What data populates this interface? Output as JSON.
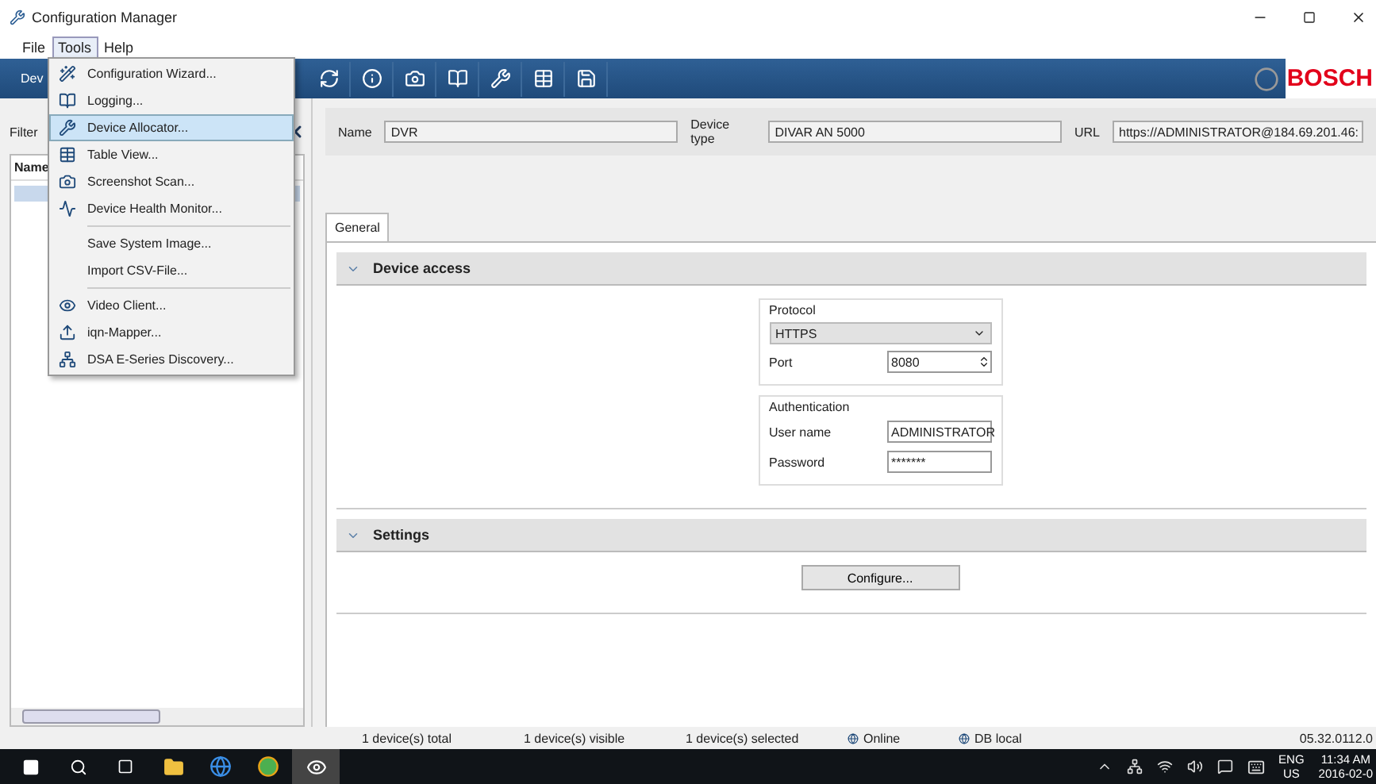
{
  "window": {
    "title": "Configuration Manager"
  },
  "menu": [
    {
      "label": "File",
      "selected": false
    },
    {
      "label": "Tools",
      "selected": true
    },
    {
      "label": "Help",
      "selected": false
    }
  ],
  "tools_menu": [
    [
      {
        "label": "Configuration Wizard...",
        "selected": false
      },
      {
        "label": "Logging...",
        "selected": false
      },
      {
        "label": "Device Allocator...",
        "selected": true
      },
      {
        "label": "Table View...",
        "selected": false
      },
      {
        "label": "Screenshot Scan...",
        "selected": false
      },
      {
        "label": "Device Health Monitor...",
        "selected": false
      }
    ],
    [
      {
        "label": "Save System Image...",
        "selected": false
      },
      {
        "label": "Import CSV-File...",
        "selected": false
      }
    ],
    [
      {
        "label": "Video Client...",
        "selected": false
      },
      {
        "label": "iqn-Mapper...",
        "selected": false
      },
      {
        "label": "DSA E-Series Discovery...",
        "selected": false
      }
    ]
  ],
  "logo": "BOSCH",
  "left_panel": {
    "tab": "Dev",
    "filter_label": "Filter",
    "column": "Name"
  },
  "device_fields": [
    {
      "label": "Name",
      "value": "DVR"
    },
    {
      "label": "Device type",
      "value": "DIVAR AN 5000"
    },
    {
      "label": "URL",
      "value": "https://ADMINISTRATOR@184.69.201.46:"
    }
  ],
  "tabs": [
    {
      "label": "General",
      "selected": true
    }
  ],
  "device_access": {
    "title": "Device access",
    "expanded": true,
    "protocol_title": "Protocol",
    "protocol": "HTTPS",
    "port_label": "Port",
    "port": "8080",
    "auth_title": "Authentication",
    "user_label": "User name",
    "user": "ADMINISTRATOR",
    "password_label": "Password",
    "password": "*******"
  },
  "settings": {
    "title": "Settings",
    "expanded": true,
    "button": "Configure..."
  },
  "status_bar": {
    "counts": [
      "1 device(s) total",
      "1 device(s) visible",
      "1 device(s) selected"
    ],
    "indicators": [
      "Online",
      "DB local"
    ],
    "version": "05.32.0112.0"
  },
  "taskbar": {
    "language": "ENG",
    "region": "US",
    "time": "11:34 AM",
    "date": "2016-02-0"
  }
}
